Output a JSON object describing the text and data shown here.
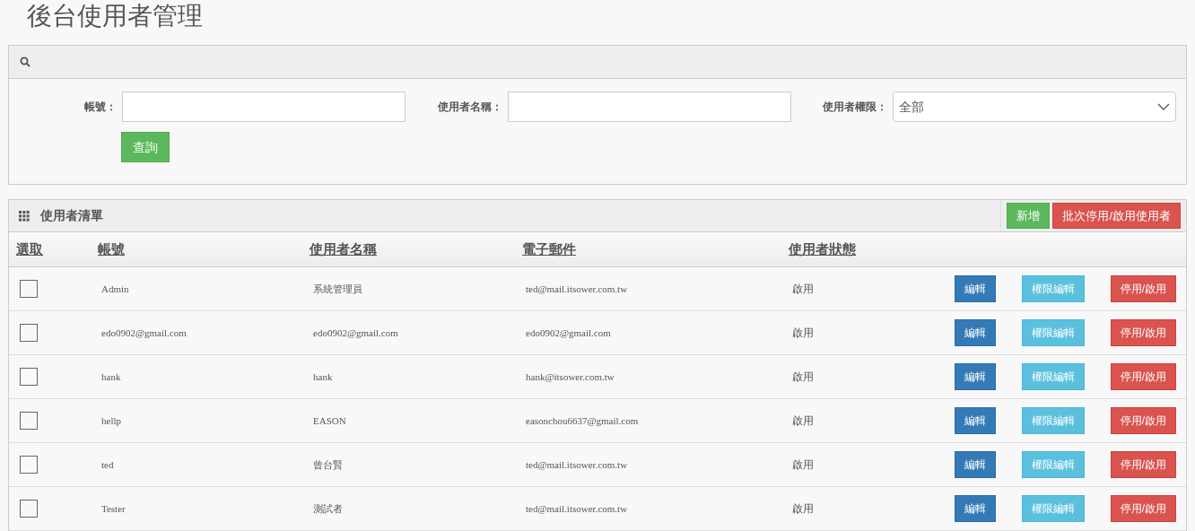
{
  "page_title": "後台使用者管理",
  "search": {
    "fields": [
      {
        "kind": "text",
        "label": "帳號："
      },
      {
        "kind": "text",
        "label": "使用者名稱："
      },
      {
        "kind": "select",
        "label": "使用者權限：",
        "value": "全部"
      }
    ],
    "submit": "查詢"
  },
  "list": {
    "title": "使用者清單",
    "actions": [
      {
        "kind": "add",
        "label": "新增"
      },
      {
        "kind": "danger",
        "label": "批次停用/啟用使用者"
      }
    ],
    "columns": [
      "選取",
      "帳號",
      "使用者名稱",
      "電子郵件",
      "使用者狀態"
    ],
    "rows": [
      {
        "checked": false,
        "account": "Admin",
        "name": "系統管理員",
        "email": "ted@mail.itsower.com.tw",
        "status": "啟用",
        "buttons": [
          "編輯",
          "權限編輯",
          "停用/啟用"
        ]
      },
      {
        "checked": false,
        "account": "edo0902@gmail.com",
        "name": "edo0902@gmail.com",
        "email": "edo0902@gmail.com",
        "status": "啟用",
        "buttons": [
          "編輯",
          "權限編輯",
          "停用/啟用"
        ]
      },
      {
        "checked": false,
        "account": "hank",
        "name": "hank",
        "email": "hank@itsower.com.tw",
        "status": "啟用",
        "buttons": [
          "編輯",
          "權限編輯",
          "停用/啟用"
        ]
      },
      {
        "checked": false,
        "account": "hellp",
        "name": "EASON",
        "email": "easonchou6637@gmail.com",
        "status": "啟用",
        "buttons": [
          "編輯",
          "權限編輯",
          "停用/啟用"
        ]
      },
      {
        "checked": false,
        "account": "ted",
        "name": "曾台賢",
        "email": "ted@mail.itsower.com.tw",
        "status": "啟用",
        "buttons": [
          "編輯",
          "權限編輯",
          "停用/啟用"
        ]
      },
      {
        "checked": false,
        "account": "Tester",
        "name": "測試者",
        "email": "ted@mail.itsower.com.tw",
        "status": "啟用",
        "buttons": [
          "編輯",
          "權限編輯",
          "停用/啟用"
        ]
      }
    ]
  }
}
